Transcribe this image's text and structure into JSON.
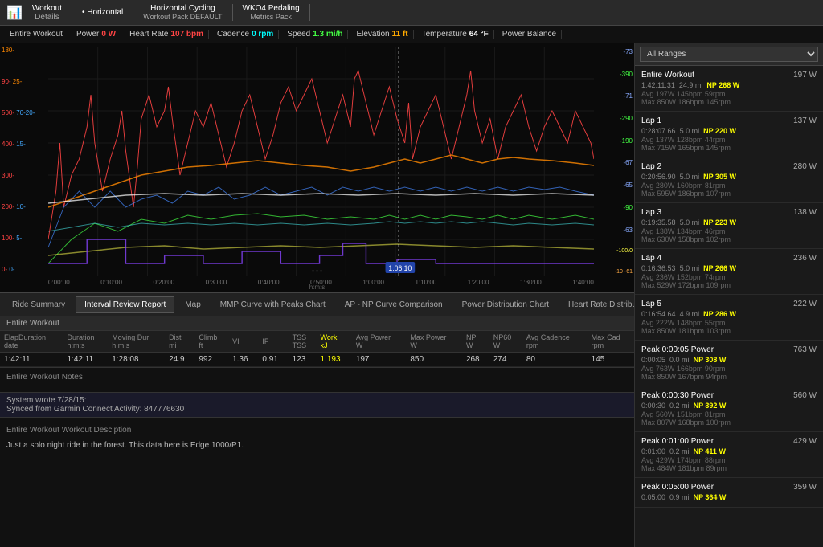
{
  "toolbar": {
    "chart_icon": "📊",
    "sections": [
      {
        "label": "Workout",
        "sub": "Details"
      },
      {
        "label": "• Horizontal",
        "sub": ""
      },
      {
        "label": "Horizontal Cycling",
        "sub": "Workout Pack DEFAULT"
      },
      {
        "label": "WKO4 Pedaling",
        "sub": "Metrics Pack"
      }
    ]
  },
  "stats_bar": {
    "items": [
      {
        "label": "Entire Workout",
        "value": "",
        "color": "white"
      },
      {
        "label": "Power",
        "value": "0 W",
        "color": "red"
      },
      {
        "label": "Heart Rate",
        "value": "107 bpm",
        "color": "red"
      },
      {
        "label": "Cadence",
        "value": "0 rpm",
        "color": "cyan"
      },
      {
        "label": "Speed",
        "value": "1.3 mi/h",
        "color": "green"
      },
      {
        "label": "Elevation",
        "value": "11 ft",
        "color": "orange"
      },
      {
        "label": "Temperature",
        "value": "64 °F",
        "color": "white"
      },
      {
        "label": "Power Balance",
        "value": "",
        "color": "cyan"
      }
    ]
  },
  "chart": {
    "y_axis_left": [
      {
        "val": "180-",
        "color": "#ff4444"
      },
      {
        "val": "90-",
        "color": "#ff4444"
      },
      {
        "val": "500-",
        "color": "#ff4444"
      },
      {
        "val": "400-",
        "color": "#ff4444"
      },
      {
        "val": "300-",
        "color": "#ff4444"
      },
      {
        "val": "200-",
        "color": "#ff4444"
      },
      {
        "val": "100-",
        "color": "#ff4444"
      },
      {
        "val": "0-",
        "color": "#ff4444"
      }
    ],
    "y_axis_right": [
      {
        "val": "-73",
        "color": "#88aaff"
      },
      {
        "val": "-390",
        "color": "#44ff44"
      },
      {
        "val": "-71",
        "color": "#88aaff"
      },
      {
        "val": "-290",
        "color": "#44ff44"
      },
      {
        "val": "-190",
        "color": "#44ff44"
      },
      {
        "val": "-67",
        "color": "#88aaff"
      },
      {
        "val": "-65",
        "color": "#88aaff"
      },
      {
        "val": "-90",
        "color": "#44ff44"
      },
      {
        "val": "-63",
        "color": "#88aaff"
      },
      {
        "val": "-100/0",
        "color": "#ffff44"
      },
      {
        "val": "-10 -61",
        "color": "#ffaa44"
      }
    ],
    "x_axis": [
      "0:00:00",
      "0:10:00",
      "0:20:00",
      "0:30:00",
      "0:40:00",
      "0:50:00",
      "1:00:00",
      "1:10:00",
      "1:20:00",
      "1:30:00",
      "1:40:00"
    ],
    "x_label": "h:m:s",
    "cursor_time": "1:06:10"
  },
  "tabs": [
    {
      "label": "Ride Summary",
      "active": false
    },
    {
      "label": "Interval Review Report",
      "active": true
    },
    {
      "label": "Map",
      "active": false
    },
    {
      "label": "MMP Curve with Peaks Chart",
      "active": false
    },
    {
      "label": "AP - NP Curve Comparison",
      "active": false
    },
    {
      "label": "Power Distribution Chart",
      "active": false
    },
    {
      "label": "Heart Rate Distribution Chart",
      "active": false
    }
  ],
  "data_table": {
    "section": "Entire Workout",
    "columns": [
      "ElapDuration date",
      "Duration h:m:s",
      "Moving Dur h:m:s",
      "Dist mi",
      "Climb ft",
      "VI",
      "IF",
      "TSS TSS",
      "Work kJ",
      "Avg Power W",
      "Max Power W",
      "NP W",
      "NP60 W",
      "Avg Cadence rpm",
      "Max Cad rpm"
    ],
    "row": [
      "1:42:11",
      "1:42:11",
      "1:28:08",
      "24.9",
      "992",
      "1.36",
      "0.91",
      "123",
      "1,193",
      "197",
      "850",
      "268",
      "274",
      "80",
      "145"
    ]
  },
  "notes": {
    "workout_notes_header": "Entire Workout Notes",
    "system_note": "System wrote 7/28/15:",
    "system_text": "Synced from Garmin Connect Activity: 847776630",
    "description_header": "Entire Workout Workout Desciption",
    "description_text": "Just a solo night ride in the forest. This data here is Edge 1000/P1."
  },
  "right_panel": {
    "range_options": [
      "All Ranges"
    ],
    "selected_range": "All Ranges",
    "entries": [
      {
        "title": "Entire Workout",
        "watts": "197 W",
        "time": "1:42:11.31",
        "distance": "24.9 mi",
        "np_label": "NP",
        "np": "268 W",
        "avg": "Avg 197W  145bpm  59rpm",
        "max": "Max 850W  186bpm  145rpm"
      },
      {
        "title": "Lap 1",
        "watts": "137 W",
        "time": "0:28:07.66",
        "distance": "5.0 mi",
        "np_label": "NP",
        "np": "220 W",
        "avg": "Avg 137W  128bpm  44rpm",
        "max": "Max 715W  165bpm  145rpm"
      },
      {
        "title": "Lap 2",
        "watts": "280 W",
        "time": "0:20:56.90",
        "distance": "5.0 mi",
        "np_label": "NP",
        "np": "305 W",
        "avg": "Avg 280W  160bpm  81rpm",
        "max": "Max 595W  186bpm  107rpm"
      },
      {
        "title": "Lap 3",
        "watts": "138 W",
        "time": "0:19:35.58",
        "distance": "5.0 mi",
        "np_label": "NP",
        "np": "223 W",
        "avg": "Avg 138W  134bpm  46rpm",
        "max": "Max 630W  158bpm  102rpm"
      },
      {
        "title": "Lap 4",
        "watts": "236 W",
        "time": "0:16:36.53",
        "distance": "5.0 mi",
        "np_label": "NP",
        "np": "266 W",
        "avg": "Avg 236W  152bpm  74rpm",
        "max": "Max 529W  172bpm  109rpm"
      },
      {
        "title": "Lap 5",
        "watts": "222 W",
        "time": "0:16:54.64",
        "distance": "4.9 mi",
        "np_label": "NP",
        "np": "286 W",
        "avg": "Avg 222W  148bpm  55rpm",
        "max": "Max 850W  181bpm  103rpm"
      },
      {
        "title": "Peak 0:00:05 Power",
        "watts": "763 W",
        "time": "0:00:05",
        "distance": "0.0 mi",
        "np_label": "NP",
        "np": "308 W",
        "avg": "Avg 763W  166bpm  90rpm",
        "max": "Max 850W  167bpm  94rpm"
      },
      {
        "title": "Peak 0:00:30 Power",
        "watts": "560 W",
        "time": "0:00:30",
        "distance": "0.2 mi",
        "np_label": "NP",
        "np": "392 W",
        "avg": "Avg 560W  151bpm  81rpm",
        "max": "Max 807W  168bpm  100rpm"
      },
      {
        "title": "Peak 0:01:00 Power",
        "watts": "429 W",
        "time": "0:01:00",
        "distance": "0.2 mi",
        "np_label": "NP",
        "np": "411 W",
        "avg": "Avg 429W  174bpm  88rpm",
        "max": "Max 484W  181bpm  89rpm"
      },
      {
        "title": "Peak 0:05:00 Power",
        "watts": "359 W",
        "time": "0:05:00",
        "distance": "0.9 mi",
        "np_label": "NP",
        "np": "364 W",
        "avg": "",
        "max": ""
      }
    ]
  }
}
